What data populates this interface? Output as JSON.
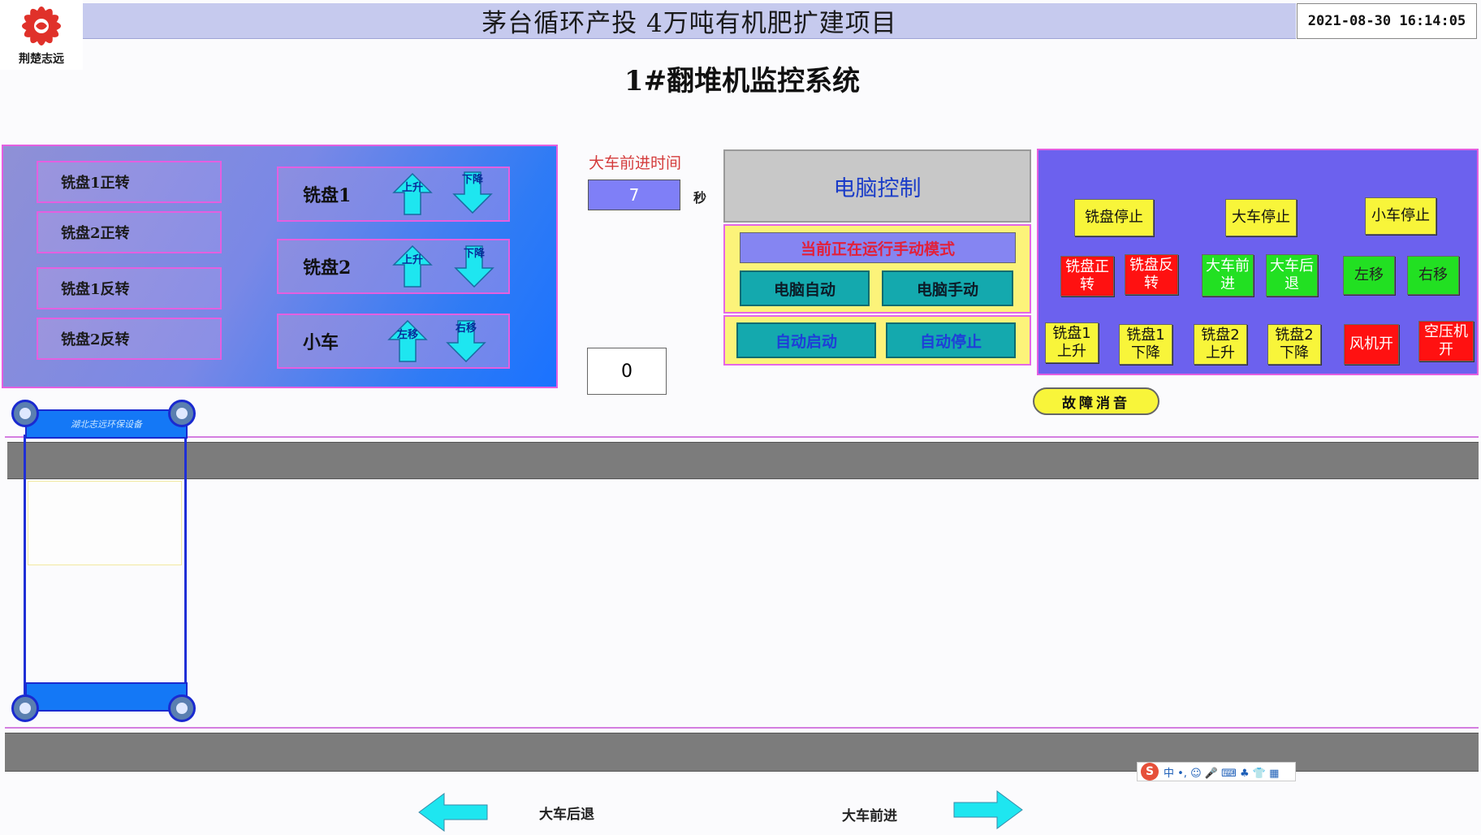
{
  "header": {
    "logo_text": "荆楚志远",
    "title": "茅台循环产投  4万吨有机肥扩建项目",
    "datetime": "2021-08-30  16:14:05",
    "subtitle": "1#翻堆机监控系统"
  },
  "left_panel": {
    "buttons": [
      "铣盘1正转",
      "铣盘2正转",
      "铣盘1反转",
      "铣盘2反转"
    ],
    "groups": [
      {
        "label": "铣盘1",
        "up": "上升",
        "down": "下降"
      },
      {
        "label": "铣盘2",
        "up": "上升",
        "down": "下降"
      },
      {
        "label": "小车",
        "up": "左移",
        "down": "右移"
      }
    ]
  },
  "timer": {
    "label": "大车前进时间",
    "value": "7",
    "unit": "秒",
    "counter": "0"
  },
  "pc_control": {
    "title": "电脑控制",
    "mode_status": "当前正在运行手动模式",
    "auto_label": "电脑自动",
    "manual_label": "电脑手动",
    "auto_start": "自动启动",
    "auto_stop": "自动停止"
  },
  "right_panel": {
    "row1": [
      "铣盘停止",
      "大车停止",
      "小车停止"
    ],
    "row2": [
      {
        "l1": "铣盘正",
        "l2": "转",
        "color": "red"
      },
      {
        "l1": "铣盘反",
        "l2": "转",
        "color": "red"
      },
      {
        "l1": "大车前",
        "l2": "进",
        "color": "green"
      },
      {
        "l1": "大车后",
        "l2": "退",
        "color": "green"
      },
      {
        "l1": "左移",
        "l2": "",
        "color": "green"
      },
      {
        "l1": "右移",
        "l2": "",
        "color": "green"
      }
    ],
    "row3": [
      {
        "l1": "铣盘1",
        "l2": "上升",
        "color": "yellow"
      },
      {
        "l1": "铣盘1",
        "l2": "下降",
        "color": "yellow"
      },
      {
        "l1": "铣盘2",
        "l2": "上升",
        "color": "yellow"
      },
      {
        "l1": "铣盘2",
        "l2": "下降",
        "color": "yellow"
      },
      {
        "l1": "风机开",
        "l2": "",
        "color": "red"
      },
      {
        "l1": "空压机",
        "l2": "开",
        "color": "red"
      }
    ],
    "fault_silence": "故障消音"
  },
  "machine": {
    "brand_text": "湖北志远环保设备"
  },
  "travel": {
    "back_label": "大车后退",
    "forward_label": "大车前进"
  },
  "ime": {
    "s": "S",
    "text": "中 •, ☺ 🎤 ⌨ ♣ 👕 ▦"
  },
  "colors": {
    "panel_border": "#e45fe0",
    "arrow_cyan": "#1ee6f0",
    "stop_yellow": "#f8f53a",
    "run_red": "#ff1111",
    "run_green": "#22e022"
  }
}
